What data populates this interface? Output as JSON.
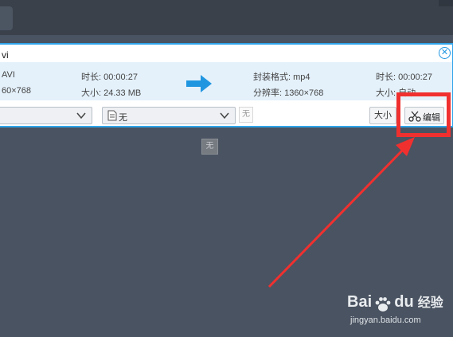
{
  "file": {
    "name_fragment": "vi",
    "close_icon": "close-icon"
  },
  "source": {
    "format": "AVI",
    "resolution": "60×768",
    "duration": "时长: 00:00:27",
    "size": "大小: 24.33 MB"
  },
  "output": {
    "container": "封装格式: mp4",
    "resolution": "分辨率: 1360×768",
    "duration": "时长: 00:00:27",
    "size": "大小: 自动"
  },
  "controls": {
    "subtitle_value": "无",
    "ghost_label": "无",
    "size_button": "大小",
    "edit_button": "编辑"
  },
  "overlay": {
    "ghost_label": "无"
  },
  "watermark": {
    "brand_a": "Bai",
    "brand_b": "du",
    "brand_cn": "经验",
    "url": "jingyan.baidu.com"
  },
  "colors": {
    "accent": "#2fa4ea",
    "highlight": "#f0302f",
    "background": "#4a5361"
  }
}
